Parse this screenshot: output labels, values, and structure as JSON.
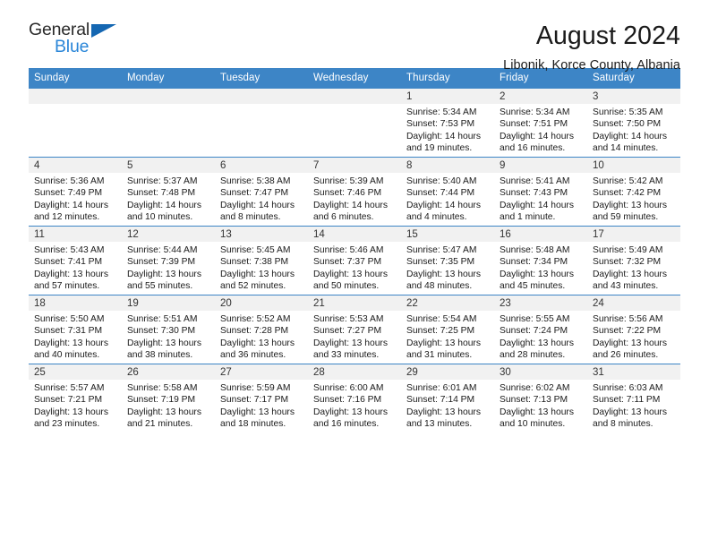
{
  "logo": {
    "word_one": "General",
    "word_two": "Blue",
    "triangle_icon": "triangle-icon",
    "brand_dark": "#2b2b2b",
    "brand_blue": "#2a86d8",
    "triangle_blue": "#1567b2"
  },
  "header": {
    "title": "August 2024",
    "subtitle": "Libonik, Korce County, Albania"
  },
  "theme": {
    "header_bg": "#3d85c6",
    "header_text": "#ffffff",
    "daynum_band_bg": "#f1f1f1",
    "cell_bg": "#ffffff",
    "border": "#3d85c6"
  },
  "weekday_headers": [
    "Sunday",
    "Monday",
    "Tuesday",
    "Wednesday",
    "Thursday",
    "Friday",
    "Saturday"
  ],
  "weeks": [
    [
      {
        "day": "",
        "empty": true
      },
      {
        "day": "",
        "empty": true
      },
      {
        "day": "",
        "empty": true
      },
      {
        "day": "",
        "empty": true
      },
      {
        "day": "1",
        "sunrise": "Sunrise: 5:34 AM",
        "sunset": "Sunset: 7:53 PM",
        "daylight_1": "Daylight: 14 hours",
        "daylight_2": "and 19 minutes."
      },
      {
        "day": "2",
        "sunrise": "Sunrise: 5:34 AM",
        "sunset": "Sunset: 7:51 PM",
        "daylight_1": "Daylight: 14 hours",
        "daylight_2": "and 16 minutes."
      },
      {
        "day": "3",
        "sunrise": "Sunrise: 5:35 AM",
        "sunset": "Sunset: 7:50 PM",
        "daylight_1": "Daylight: 14 hours",
        "daylight_2": "and 14 minutes."
      }
    ],
    [
      {
        "day": "4",
        "sunrise": "Sunrise: 5:36 AM",
        "sunset": "Sunset: 7:49 PM",
        "daylight_1": "Daylight: 14 hours",
        "daylight_2": "and 12 minutes."
      },
      {
        "day": "5",
        "sunrise": "Sunrise: 5:37 AM",
        "sunset": "Sunset: 7:48 PM",
        "daylight_1": "Daylight: 14 hours",
        "daylight_2": "and 10 minutes."
      },
      {
        "day": "6",
        "sunrise": "Sunrise: 5:38 AM",
        "sunset": "Sunset: 7:47 PM",
        "daylight_1": "Daylight: 14 hours",
        "daylight_2": "and 8 minutes."
      },
      {
        "day": "7",
        "sunrise": "Sunrise: 5:39 AM",
        "sunset": "Sunset: 7:46 PM",
        "daylight_1": "Daylight: 14 hours",
        "daylight_2": "and 6 minutes."
      },
      {
        "day": "8",
        "sunrise": "Sunrise: 5:40 AM",
        "sunset": "Sunset: 7:44 PM",
        "daylight_1": "Daylight: 14 hours",
        "daylight_2": "and 4 minutes."
      },
      {
        "day": "9",
        "sunrise": "Sunrise: 5:41 AM",
        "sunset": "Sunset: 7:43 PM",
        "daylight_1": "Daylight: 14 hours",
        "daylight_2": "and 1 minute."
      },
      {
        "day": "10",
        "sunrise": "Sunrise: 5:42 AM",
        "sunset": "Sunset: 7:42 PM",
        "daylight_1": "Daylight: 13 hours",
        "daylight_2": "and 59 minutes."
      }
    ],
    [
      {
        "day": "11",
        "sunrise": "Sunrise: 5:43 AM",
        "sunset": "Sunset: 7:41 PM",
        "daylight_1": "Daylight: 13 hours",
        "daylight_2": "and 57 minutes."
      },
      {
        "day": "12",
        "sunrise": "Sunrise: 5:44 AM",
        "sunset": "Sunset: 7:39 PM",
        "daylight_1": "Daylight: 13 hours",
        "daylight_2": "and 55 minutes."
      },
      {
        "day": "13",
        "sunrise": "Sunrise: 5:45 AM",
        "sunset": "Sunset: 7:38 PM",
        "daylight_1": "Daylight: 13 hours",
        "daylight_2": "and 52 minutes."
      },
      {
        "day": "14",
        "sunrise": "Sunrise: 5:46 AM",
        "sunset": "Sunset: 7:37 PM",
        "daylight_1": "Daylight: 13 hours",
        "daylight_2": "and 50 minutes."
      },
      {
        "day": "15",
        "sunrise": "Sunrise: 5:47 AM",
        "sunset": "Sunset: 7:35 PM",
        "daylight_1": "Daylight: 13 hours",
        "daylight_2": "and 48 minutes."
      },
      {
        "day": "16",
        "sunrise": "Sunrise: 5:48 AM",
        "sunset": "Sunset: 7:34 PM",
        "daylight_1": "Daylight: 13 hours",
        "daylight_2": "and 45 minutes."
      },
      {
        "day": "17",
        "sunrise": "Sunrise: 5:49 AM",
        "sunset": "Sunset: 7:32 PM",
        "daylight_1": "Daylight: 13 hours",
        "daylight_2": "and 43 minutes."
      }
    ],
    [
      {
        "day": "18",
        "sunrise": "Sunrise: 5:50 AM",
        "sunset": "Sunset: 7:31 PM",
        "daylight_1": "Daylight: 13 hours",
        "daylight_2": "and 40 minutes."
      },
      {
        "day": "19",
        "sunrise": "Sunrise: 5:51 AM",
        "sunset": "Sunset: 7:30 PM",
        "daylight_1": "Daylight: 13 hours",
        "daylight_2": "and 38 minutes."
      },
      {
        "day": "20",
        "sunrise": "Sunrise: 5:52 AM",
        "sunset": "Sunset: 7:28 PM",
        "daylight_1": "Daylight: 13 hours",
        "daylight_2": "and 36 minutes."
      },
      {
        "day": "21",
        "sunrise": "Sunrise: 5:53 AM",
        "sunset": "Sunset: 7:27 PM",
        "daylight_1": "Daylight: 13 hours",
        "daylight_2": "and 33 minutes."
      },
      {
        "day": "22",
        "sunrise": "Sunrise: 5:54 AM",
        "sunset": "Sunset: 7:25 PM",
        "daylight_1": "Daylight: 13 hours",
        "daylight_2": "and 31 minutes."
      },
      {
        "day": "23",
        "sunrise": "Sunrise: 5:55 AM",
        "sunset": "Sunset: 7:24 PM",
        "daylight_1": "Daylight: 13 hours",
        "daylight_2": "and 28 minutes."
      },
      {
        "day": "24",
        "sunrise": "Sunrise: 5:56 AM",
        "sunset": "Sunset: 7:22 PM",
        "daylight_1": "Daylight: 13 hours",
        "daylight_2": "and 26 minutes."
      }
    ],
    [
      {
        "day": "25",
        "sunrise": "Sunrise: 5:57 AM",
        "sunset": "Sunset: 7:21 PM",
        "daylight_1": "Daylight: 13 hours",
        "daylight_2": "and 23 minutes."
      },
      {
        "day": "26",
        "sunrise": "Sunrise: 5:58 AM",
        "sunset": "Sunset: 7:19 PM",
        "daylight_1": "Daylight: 13 hours",
        "daylight_2": "and 21 minutes."
      },
      {
        "day": "27",
        "sunrise": "Sunrise: 5:59 AM",
        "sunset": "Sunset: 7:17 PM",
        "daylight_1": "Daylight: 13 hours",
        "daylight_2": "and 18 minutes."
      },
      {
        "day": "28",
        "sunrise": "Sunrise: 6:00 AM",
        "sunset": "Sunset: 7:16 PM",
        "daylight_1": "Daylight: 13 hours",
        "daylight_2": "and 16 minutes."
      },
      {
        "day": "29",
        "sunrise": "Sunrise: 6:01 AM",
        "sunset": "Sunset: 7:14 PM",
        "daylight_1": "Daylight: 13 hours",
        "daylight_2": "and 13 minutes."
      },
      {
        "day": "30",
        "sunrise": "Sunrise: 6:02 AM",
        "sunset": "Sunset: 7:13 PM",
        "daylight_1": "Daylight: 13 hours",
        "daylight_2": "and 10 minutes."
      },
      {
        "day": "31",
        "sunrise": "Sunrise: 6:03 AM",
        "sunset": "Sunset: 7:11 PM",
        "daylight_1": "Daylight: 13 hours",
        "daylight_2": "and 8 minutes."
      }
    ]
  ]
}
